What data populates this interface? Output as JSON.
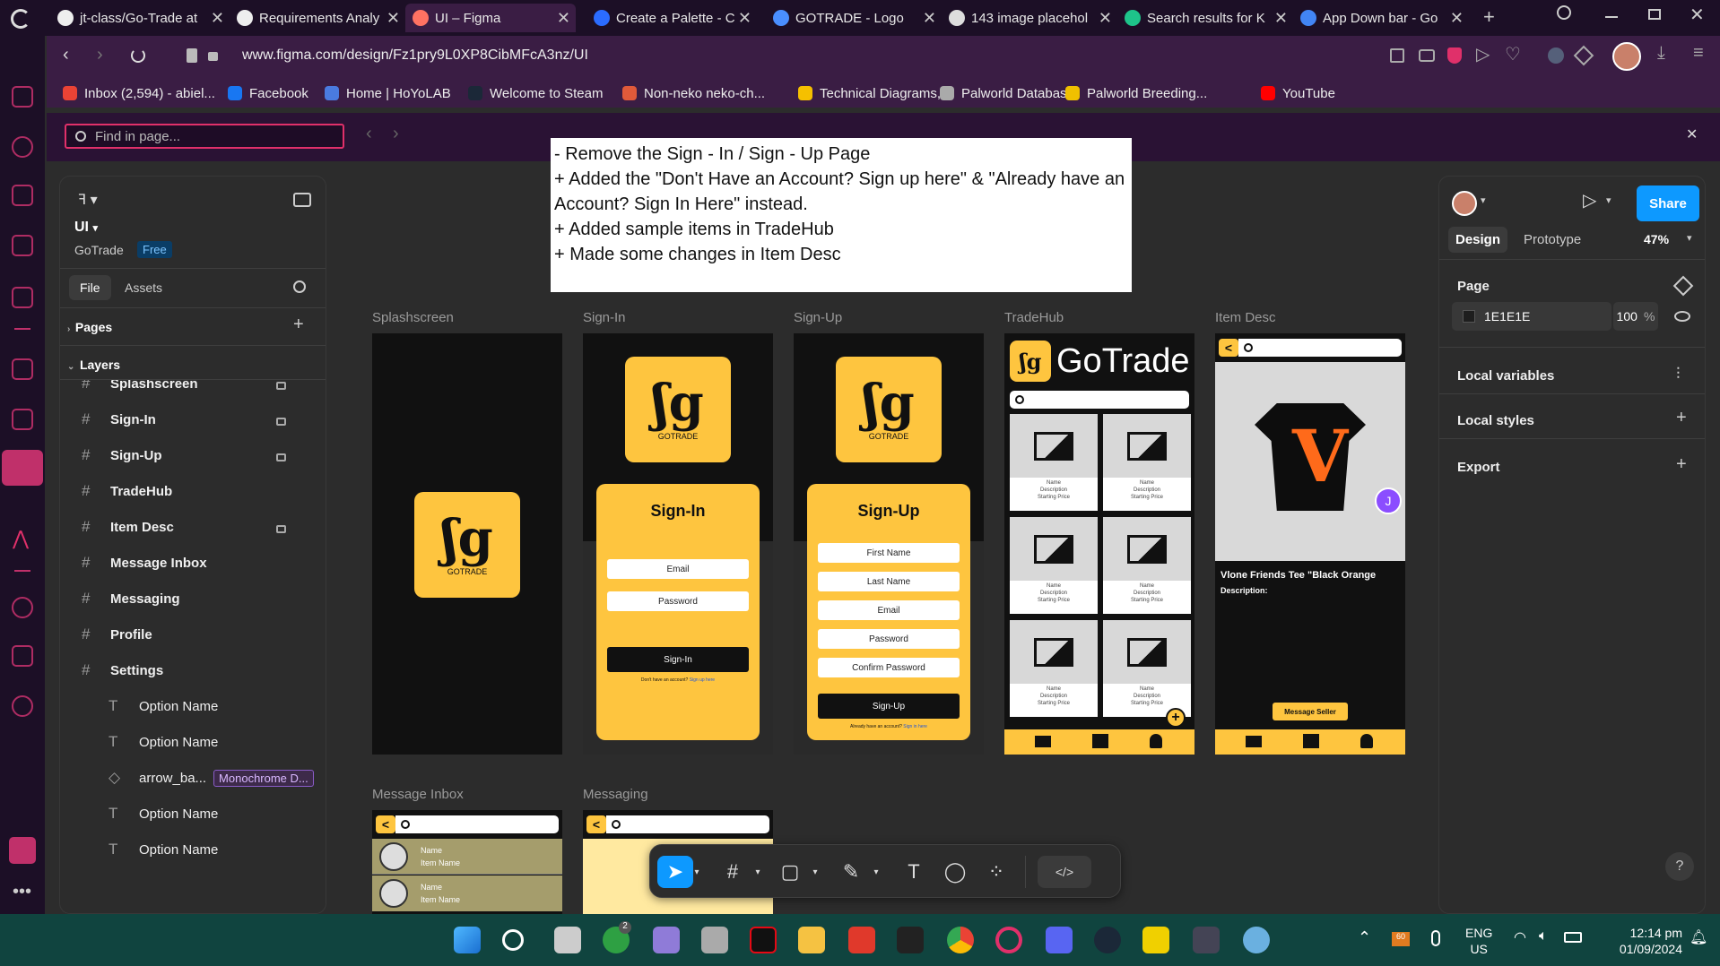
{
  "browser": {
    "tabs": [
      {
        "label": "jt-class/Go-Trade at"
      },
      {
        "label": "Requirements Analy"
      },
      {
        "label": "UI – Figma"
      },
      {
        "label": "Create a Palette - C"
      },
      {
        "label": "GOTRADE - Logo"
      },
      {
        "label": "143 image placehol"
      },
      {
        "label": "Search results for K"
      },
      {
        "label": "App Down bar - Go"
      }
    ],
    "url": "www.figma.com/design/Fz1pry9L0XP8CibMFcA3nz/UI",
    "bookmarks": [
      {
        "label": "Inbox (2,594) - abiel..."
      },
      {
        "label": "Facebook"
      },
      {
        "label": "Home | HoYoLAB"
      },
      {
        "label": "Welcome to Steam"
      },
      {
        "label": "Non-neko neko-ch..."
      },
      {
        "label": "Technical Diagrams,..."
      },
      {
        "label": "Palworld Database"
      },
      {
        "label": "Palworld Breeding..."
      },
      {
        "label": "YouTube"
      }
    ],
    "find_placeholder": "Find in page..."
  },
  "figma": {
    "file_name": "UI",
    "project": "GoTrade",
    "plan_badge": "Free",
    "tabs": {
      "file": "File",
      "assets": "Assets"
    },
    "pages_label": "Pages",
    "layers_label": "Layers",
    "layers": [
      {
        "label": "Splashscreen",
        "type": "frame",
        "locked": true
      },
      {
        "label": "Sign-In",
        "type": "frame",
        "locked": true
      },
      {
        "label": "Sign-Up",
        "type": "frame",
        "locked": true
      },
      {
        "label": "TradeHub",
        "type": "frame",
        "locked": false
      },
      {
        "label": "Item Desc",
        "type": "frame",
        "locked": true
      },
      {
        "label": "Message Inbox",
        "type": "frame",
        "locked": false
      },
      {
        "label": "Messaging",
        "type": "frame",
        "locked": false
      },
      {
        "label": "Profile",
        "type": "frame",
        "locked": false
      },
      {
        "label": "Settings",
        "type": "frame",
        "locked": false
      },
      {
        "label": "Option Name",
        "type": "text",
        "locked": false
      },
      {
        "label": "Option Name",
        "type": "text",
        "locked": false
      },
      {
        "label": "arrow_ba...",
        "type": "component",
        "locked": false,
        "badge": "Monochrome D..."
      },
      {
        "label": "Option Name",
        "type": "text",
        "locked": false
      },
      {
        "label": "Option Name",
        "type": "text",
        "locked": false
      }
    ],
    "right_panel": {
      "share": "Share",
      "design_tab": "Design",
      "prototype_tab": "Prototype",
      "zoom": "47%",
      "page_label": "Page",
      "page_color": "1E1E1E",
      "page_opacity": "100",
      "percent": "%",
      "local_variables": "Local variables",
      "local_styles": "Local styles",
      "export": "Export",
      "help": "?"
    }
  },
  "changelog": [
    "- Remove the Sign - In / Sign - Up Page",
    "+ Added the \"Don't Have an Account? Sign up here\" & \"Already have an Account? Sign In Here\" instead.",
    "+ Added sample items in TradeHub",
    "+ Made some changes in Item Desc"
  ],
  "frames": {
    "splash": {
      "label": "Splashscreen",
      "logo_text": "GOTRADE"
    },
    "signin": {
      "label": "Sign-In",
      "title": "Sign-In",
      "fields": [
        "Email",
        "Password"
      ],
      "button": "Sign-In",
      "footer": "Don't have an account?",
      "footer_link": "Sign up here",
      "logo_text": "GOTRADE"
    },
    "signup": {
      "label": "Sign-Up",
      "title": "Sign-Up",
      "fields": [
        "First Name",
        "Last Name",
        "Email",
        "Password",
        "Confirm Password"
      ],
      "button": "Sign-Up",
      "footer": "Already have an account?",
      "footer_link": "Sign in here",
      "logo_text": "GOTRADE"
    },
    "tradehub": {
      "label": "TradeHub",
      "brand": "GoTrade",
      "tile_lines": [
        "Name",
        "Description",
        "Starting Price"
      ]
    },
    "itemdesc": {
      "label": "Item Desc",
      "product": "Vlone Friends Tee \"Black Orange",
      "description": "Description:",
      "button": "Message Seller",
      "avatar": "J"
    },
    "inbox": {
      "label": "Message Inbox",
      "rows": [
        {
          "name": "Name",
          "item": "Item Name"
        },
        {
          "name": "Name",
          "item": "Item Name"
        }
      ]
    },
    "messaging": {
      "label": "Messaging"
    }
  },
  "taskbar": {
    "lang": "ENG",
    "region": "US",
    "time": "12:14 pm",
    "date": "01/09/2024",
    "battery": "60",
    "badge": "2"
  },
  "colors": {
    "accent": "#fec53f",
    "figma_blue": "#0d99ff",
    "browser": "#3a1d44"
  }
}
